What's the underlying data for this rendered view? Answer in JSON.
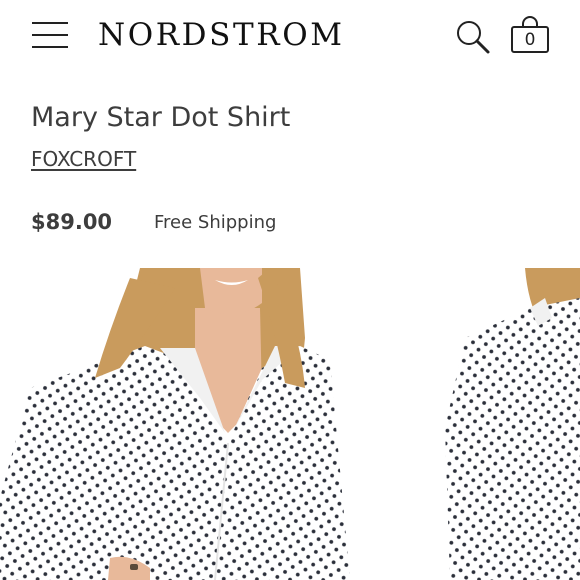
{
  "header": {
    "logo": "NORDSTROM",
    "bag_count": "0",
    "icons": {
      "menu": "hamburger-menu-icon",
      "search": "search-icon",
      "bag": "shopping-bag-icon"
    }
  },
  "product": {
    "title": "Mary Star Dot Shirt",
    "brand": "FOXCROFT",
    "price": "$89.00",
    "shipping": "Free Shipping"
  },
  "colors": {
    "text": "#393939",
    "shirt": "#ffffff",
    "dot": "#2b2f3a",
    "hair": "#c99b5d",
    "skin": "#e8b99a"
  }
}
